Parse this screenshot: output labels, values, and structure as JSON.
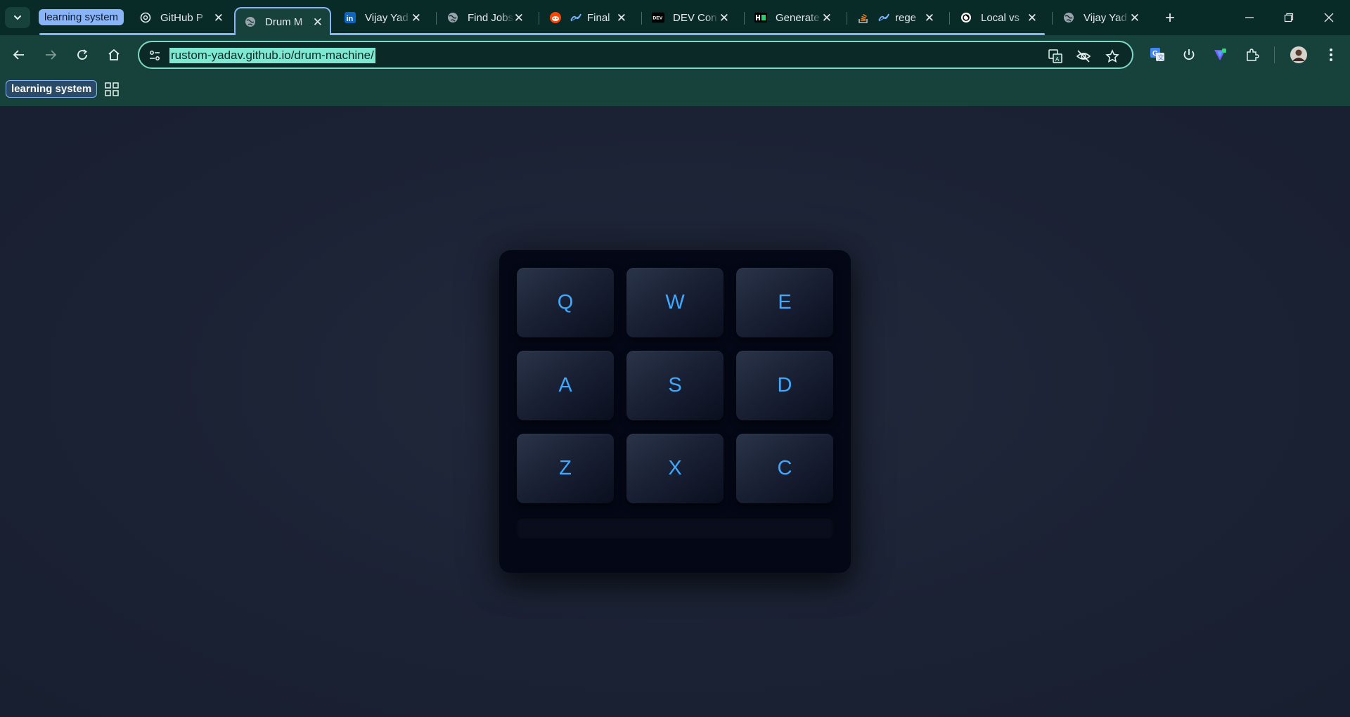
{
  "browser": {
    "tab_group": {
      "label": "learning system",
      "color": "#8ab4f8"
    },
    "tabs": [
      {
        "label": "GitHub P",
        "favicon": "openai-icon",
        "active": false
      },
      {
        "label": "Drum M",
        "favicon": "globe-icon",
        "active": true
      },
      {
        "label": "Vijay Yad",
        "favicon": "linkedin-icon",
        "active": false
      },
      {
        "label": "Find Jobs",
        "favicon": "globe-icon",
        "active": false
      },
      {
        "label": "Final",
        "favicon": "reddit-icon",
        "active": false
      },
      {
        "label": "DEV Con",
        "favicon": "dev-icon",
        "active": false
      },
      {
        "label": "Generate",
        "favicon": "hashnode-icon",
        "active": false
      },
      {
        "label": "rege",
        "favicon": "stackoverflow-icon",
        "active": false
      },
      {
        "label": "Local vs",
        "favicon": "openai-icon",
        "active": false
      },
      {
        "label": "Vijay Yad",
        "favicon": "globe-icon",
        "active": false
      }
    ],
    "new_tab_symbol": "+",
    "address_bar": {
      "url": "rustom-yadav.github.io/drum-machine/"
    },
    "bookmarks": {
      "group_chip": "learning system"
    }
  },
  "colors": {
    "tabstrip": "#082b28",
    "toolbar": "#16423b",
    "page_background": "#1a2233",
    "pad_text": "#3fa9ff",
    "url_highlight": "#7fe8d0"
  },
  "drum_machine": {
    "pads": [
      {
        "key": "Q"
      },
      {
        "key": "W"
      },
      {
        "key": "E"
      },
      {
        "key": "A"
      },
      {
        "key": "S"
      },
      {
        "key": "D"
      },
      {
        "key": "Z"
      },
      {
        "key": "X"
      },
      {
        "key": "C"
      }
    ],
    "display_text": ""
  }
}
